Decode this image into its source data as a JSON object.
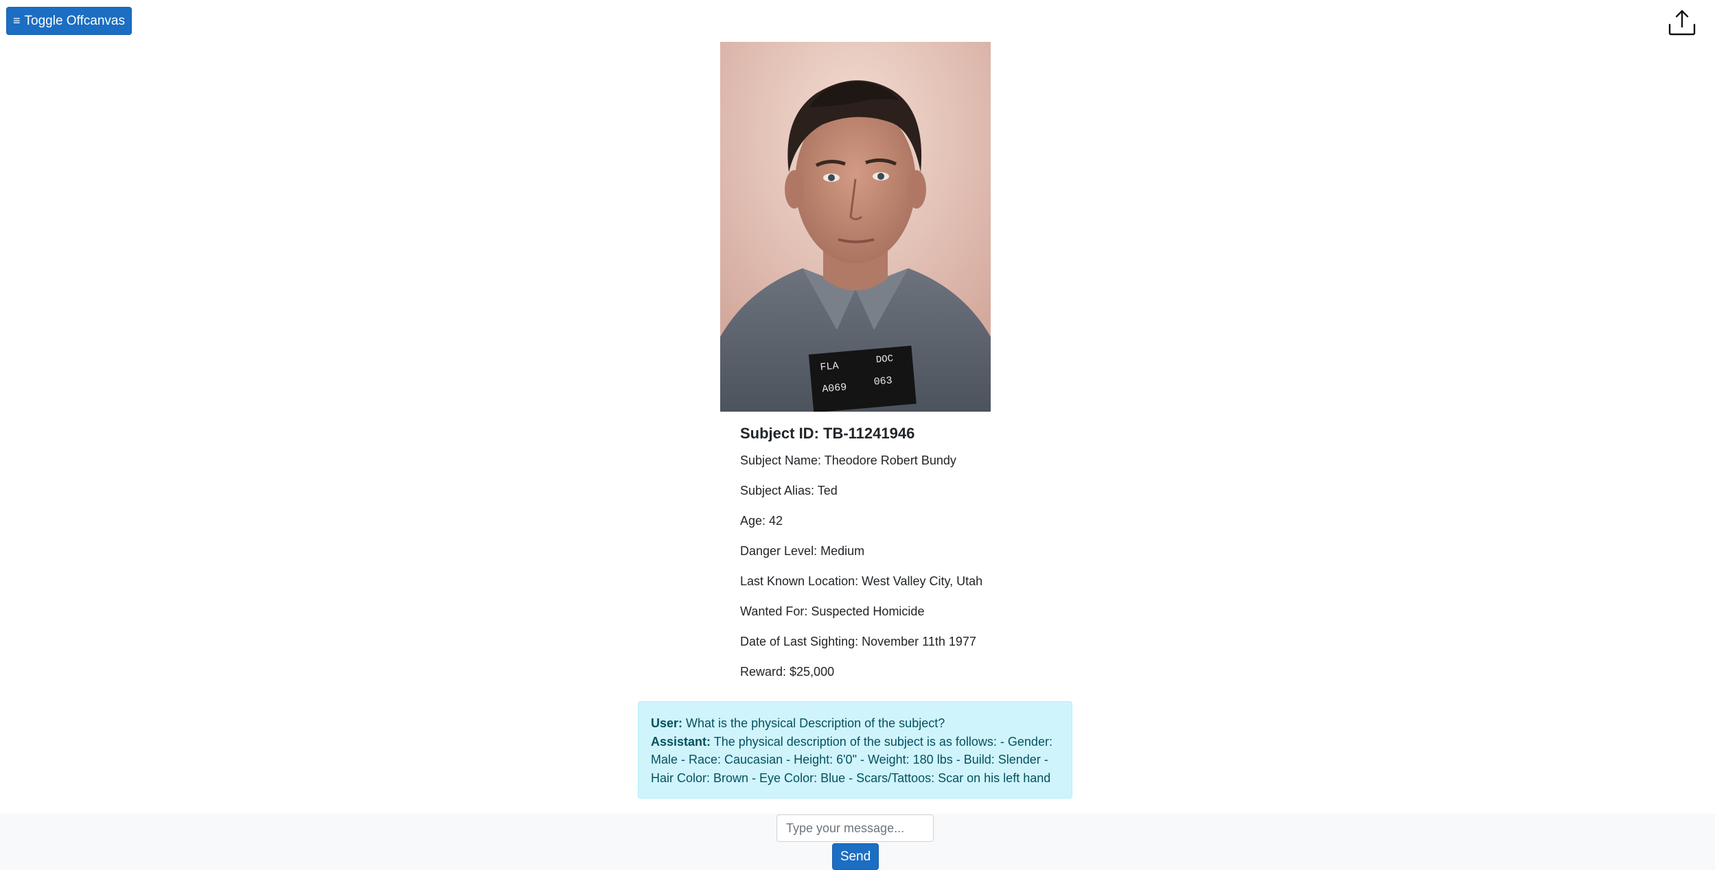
{
  "header": {
    "toggle_label": "Toggle Offcanvas",
    "toggle_icon": "hamburger-icon",
    "upload_icon": "upload-icon"
  },
  "subject": {
    "id_label": "Subject ID: TB-11241946",
    "fields": [
      "Subject Name: Theodore Robert Bundy",
      "Subject Alias: Ted",
      "Age: 42",
      "Danger Level: Medium",
      "Last Known Location: West Valley City, Utah",
      "Wanted For: Suspected Homicide",
      "Date of Last Sighting: November 11th 1977",
      "Reward: $25,000"
    ],
    "placard_text": [
      "FLA",
      "DOC",
      "A069",
      "063"
    ]
  },
  "chat": {
    "user_label": "User:",
    "user_message": "What is the physical Description of the subject?",
    "assistant_label": "Assistant:",
    "assistant_message": "The physical description of the subject is as follows: - Gender: Male - Race: Caucasian - Height: 6'0\" - Weight: 180 lbs - Build: Slender - Hair Color: Brown - Eye Color: Blue - Scars/Tattoos: Scar on his left hand"
  },
  "composer": {
    "placeholder": "Type your message...",
    "value": "",
    "send_label": "Send"
  },
  "colors": {
    "primary": "#1b6ec2",
    "alert_bg": "#cff4fc",
    "alert_text": "#055160",
    "footer_bg": "#f8f9fa"
  }
}
